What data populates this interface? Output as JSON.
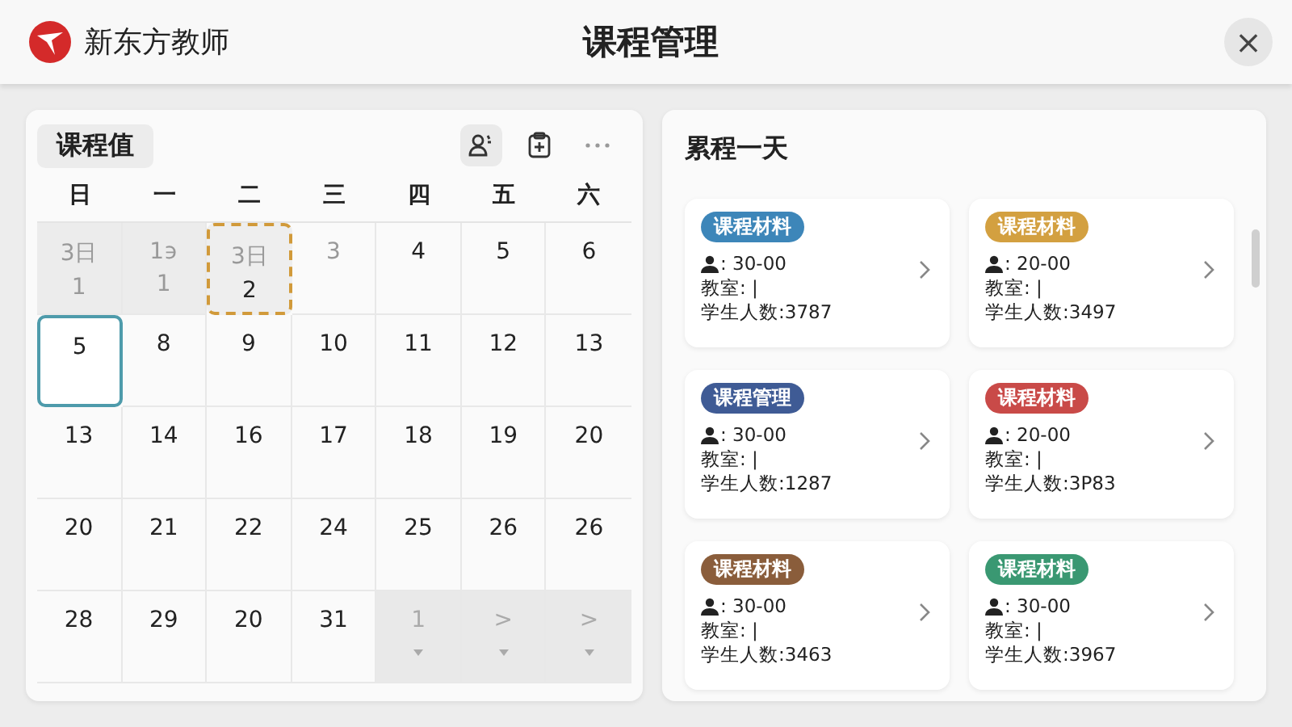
{
  "app": {
    "logo_text": "新东方教师",
    "title": "课程管理",
    "close": "×"
  },
  "calendar": {
    "title": "课程值",
    "weekdays": [
      "日",
      "一",
      "二",
      "三",
      "四",
      "五",
      "六"
    ],
    "weeks": [
      [
        {
          "label": "3日",
          "sub": "1",
          "kind": "outside"
        },
        {
          "label": "1϶",
          "sub": "1",
          "kind": "outside"
        },
        {
          "label": "3日",
          "sub": "2",
          "kind": "picked"
        },
        {
          "label": "3",
          "kind": "faded"
        },
        {
          "label": "4",
          "kind": "plain"
        },
        {
          "label": "5",
          "kind": "plain"
        },
        {
          "label": "6",
          "kind": "plain"
        }
      ],
      [
        {
          "label": "5",
          "kind": "today"
        },
        {
          "label": "8",
          "kind": "plain"
        },
        {
          "label": "9",
          "kind": "plain"
        },
        {
          "label": "10",
          "kind": "plain"
        },
        {
          "label": "11",
          "kind": "plain"
        },
        {
          "label": "12",
          "kind": "plain"
        },
        {
          "label": "13",
          "kind": "plain"
        }
      ],
      [
        {
          "label": "13",
          "kind": "plain"
        },
        {
          "label": "14",
          "kind": "plain"
        },
        {
          "label": "16",
          "kind": "plain"
        },
        {
          "label": "17",
          "kind": "plain"
        },
        {
          "label": "18",
          "kind": "plain"
        },
        {
          "label": "19",
          "kind": "plain"
        },
        {
          "label": "20",
          "kind": "plain"
        }
      ],
      [
        {
          "label": "20",
          "kind": "plain"
        },
        {
          "label": "21",
          "kind": "plain"
        },
        {
          "label": "22",
          "kind": "plain"
        },
        {
          "label": "24",
          "kind": "plain"
        },
        {
          "label": "25",
          "kind": "plain"
        },
        {
          "label": "26",
          "kind": "plain"
        },
        {
          "label": "26",
          "kind": "plain"
        }
      ],
      [
        {
          "label": "28",
          "kind": "plain"
        },
        {
          "label": "29",
          "kind": "plain"
        },
        {
          "label": "20",
          "kind": "plain"
        },
        {
          "label": "31",
          "kind": "plain"
        },
        {
          "label": "1",
          "kind": "next"
        },
        {
          "label": ">",
          "kind": "next"
        },
        {
          "label": ">",
          "kind": "next"
        }
      ]
    ]
  },
  "schedule": {
    "title": "累程一天",
    "cards": [
      {
        "tag": "课程材料",
        "color": "#3d86b9",
        "time": ": 30-00",
        "room_label": "教室:",
        "room": "|",
        "count_label": "学生人数:",
        "count": "3787"
      },
      {
        "tag": "课程材料",
        "color": "#d3a040",
        "time": ": 20-00",
        "room_label": "教室:",
        "room": "|",
        "count_label": "学生人数:",
        "count": "3497"
      },
      {
        "tag": "课程管理",
        "color": "#3f5b95",
        "time": ": 30-00",
        "room_label": "教室:",
        "room": "|",
        "count_label": "学生人数:",
        "count": "1287"
      },
      {
        "tag": "课程材料",
        "color": "#c94a48",
        "time": ": 20-00",
        "room_label": "教室:",
        "room": "|",
        "count_label": "学生人数:",
        "count": "3P83"
      },
      {
        "tag": "课程材料",
        "color": "#8a5d3b",
        "time": ": 30-00",
        "room_label": "教室:",
        "room": "|",
        "count_label": "学生人数:",
        "count": "3463"
      },
      {
        "tag": "课程材料",
        "color": "#3a9872",
        "time": ": 30-00",
        "room_label": "教室:",
        "room": "|",
        "count_label": "学生人数:",
        "count": "3967"
      }
    ]
  }
}
